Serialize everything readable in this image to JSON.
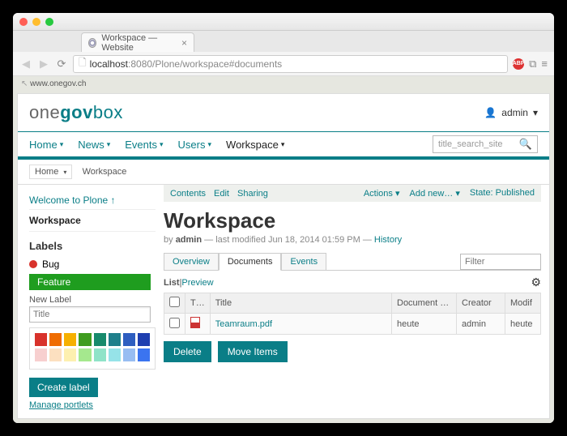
{
  "browser": {
    "tab_title": "Workspace — Website",
    "url_host": "localhost",
    "url_path": ":8080/Plone/workspace#documents",
    "abp_label": "ABP"
  },
  "backlink": "www.onegov.ch",
  "logo": {
    "one": "one",
    "gov": "gov",
    "box": "box"
  },
  "user": {
    "name": "admin",
    "caret": "▾"
  },
  "nav": [
    {
      "label": "Home",
      "active": false
    },
    {
      "label": "News",
      "active": false
    },
    {
      "label": "Events",
      "active": false
    },
    {
      "label": "Users",
      "active": false
    },
    {
      "label": "Workspace",
      "active": true
    }
  ],
  "search_placeholder": "title_search_site",
  "breadcrumbs": {
    "home": "Home",
    "caret": "▾",
    "current": "Workspace"
  },
  "sidebar": {
    "welcome": "Welcome to Plone ↑",
    "current": "Workspace",
    "labels_heading": "Labels",
    "bug_label": "Bug",
    "feature_label": "Feature",
    "new_label_caption": "New Label",
    "title_placeholder": "Title",
    "create_label": "Create label",
    "manage_portlets": "Manage portlets",
    "palette_row1": [
      "#d8322b",
      "#ef6c00",
      "#f6b000",
      "#3f9c1f",
      "#178a6c",
      "#1f7f8b",
      "#2e5ec0",
      "#1f3fb0"
    ],
    "palette_row2": [
      "#f7cfcf",
      "#fce0c0",
      "#fdf0b0",
      "#a5e88e",
      "#8fe3c8",
      "#96e3e8",
      "#97bdf2",
      "#3b74f0"
    ]
  },
  "greybar": {
    "contents": "Contents",
    "edit": "Edit",
    "sharing": "Sharing",
    "actions": "Actions ▾",
    "addnew": "Add new… ▾",
    "state": "State: Published"
  },
  "page": {
    "title": "Workspace",
    "by": "by",
    "author": "admin",
    "modified": "— last modified Jun 18, 2014 01:59 PM —",
    "history": "History"
  },
  "subtabs": {
    "overview": "Overview",
    "documents": "Documents",
    "events": "Events",
    "filter_placeholder": "Filter"
  },
  "listpreview": {
    "list": "List",
    "sep": " | ",
    "preview": "Preview"
  },
  "table": {
    "headers": {
      "checkbox": "",
      "type": "T…",
      "title": "Title",
      "docdate": "Document …",
      "creator": "Creator",
      "modified": "Modif"
    },
    "row": {
      "title": "Teamraum.pdf",
      "docdate": "heute",
      "creator": "admin",
      "modified": "heute"
    }
  },
  "buttons": {
    "delete": "Delete",
    "move": "Move Items"
  }
}
